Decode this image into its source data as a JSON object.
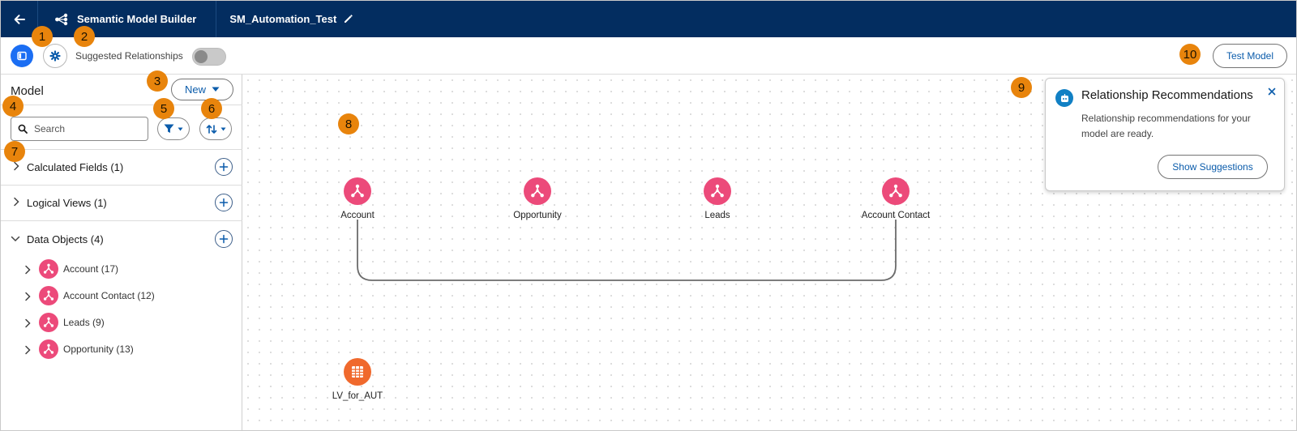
{
  "header": {
    "app_title": "Semantic Model Builder",
    "model_name": "SM_Automation_Test"
  },
  "toolbar": {
    "suggested_relationships_label": "Suggested Relationships",
    "suggested_relationships_on": false,
    "test_model_label": "Test Model"
  },
  "sidebar": {
    "title": "Model",
    "new_label": "New",
    "search": {
      "placeholder": "Search",
      "value": ""
    },
    "sections": [
      {
        "label": "Calculated Fields (1)",
        "expanded": false
      },
      {
        "label": "Logical Views (1)",
        "expanded": false
      },
      {
        "label": "Data Objects (4)",
        "expanded": true
      }
    ],
    "data_objects": [
      {
        "label": "Account (17)"
      },
      {
        "label": "Account Contact (12)"
      },
      {
        "label": "Leads (9)"
      },
      {
        "label": "Opportunity (13)"
      }
    ]
  },
  "canvas": {
    "nodes": [
      {
        "label": "Account",
        "type": "data-object"
      },
      {
        "label": "Opportunity",
        "type": "data-object"
      },
      {
        "label": "Leads",
        "type": "data-object"
      },
      {
        "label": "Account Contact",
        "type": "data-object"
      },
      {
        "label": "LV_for_AUT",
        "type": "logical-view"
      }
    ],
    "relationships": [
      {
        "from": "Account",
        "to": "Account Contact"
      }
    ]
  },
  "recommendation": {
    "title": "Relationship Recommendations",
    "body": "Relationship recommendations for your model are ready.",
    "button_label": "Show Suggestions"
  },
  "callouts": [
    "1",
    "2",
    "3",
    "4",
    "5",
    "6",
    "7",
    "8",
    "9",
    "10"
  ],
  "colors": {
    "header_bg": "#032d60",
    "brand_blue": "#0b5cab",
    "data_object": "#ec4a7a",
    "logical_view": "#f0692d",
    "callout": "#e8840c"
  }
}
